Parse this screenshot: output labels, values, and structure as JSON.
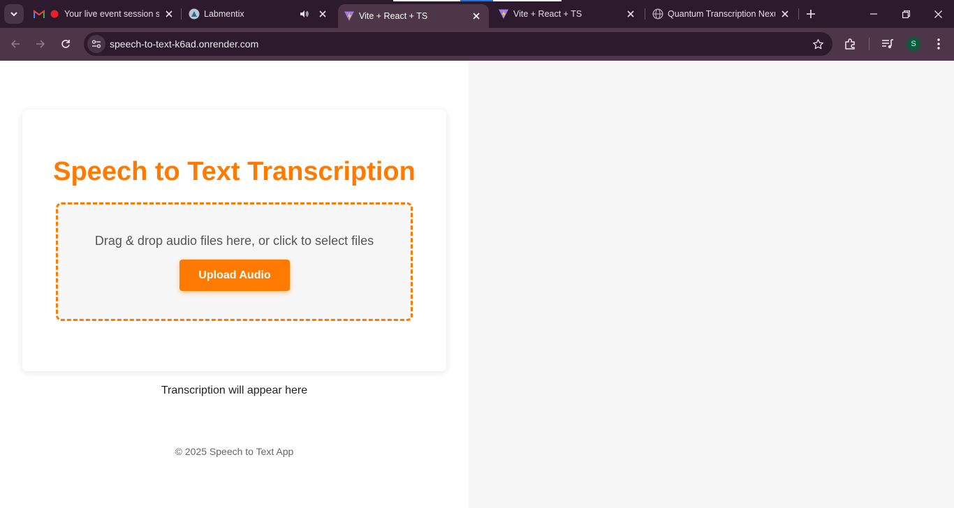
{
  "browser": {
    "tabs": [
      {
        "title": "",
        "favicon": "gmail-icon"
      },
      {
        "title": "Your live event session st",
        "favicon": "recording-dot-icon"
      },
      {
        "title": "Labmentix",
        "favicon": "labmentix-icon",
        "audio": true
      },
      {
        "title": "Vite + React + TS",
        "favicon": "vite-icon",
        "active": true
      },
      {
        "title": "Vite + React + TS",
        "favicon": "vite-icon"
      },
      {
        "title": "Quantum Transcription Nexu",
        "favicon": "globe-icon"
      }
    ],
    "url": "speech-to-text-k6ad.onrender.com",
    "profile_initial": "S",
    "colors": {
      "tabstrip": "#2d1a2d",
      "toolbar": "#4e3649",
      "omnibox": "#2d1a2d",
      "avatar": "#0c5a42"
    }
  },
  "app": {
    "heading": "Speech to Text Transcription",
    "dropzone_text": "Drag & drop audio files here, or click to select files",
    "upload_button": "Upload Audio",
    "transcription_placeholder": "Transcription will appear here",
    "footer": "© 2025 Speech to Text App",
    "colors": {
      "accent": "#ff7a00",
      "dropzone_bg": "#f7f7f7",
      "right_panel_bg": "#f7f7f7"
    }
  }
}
